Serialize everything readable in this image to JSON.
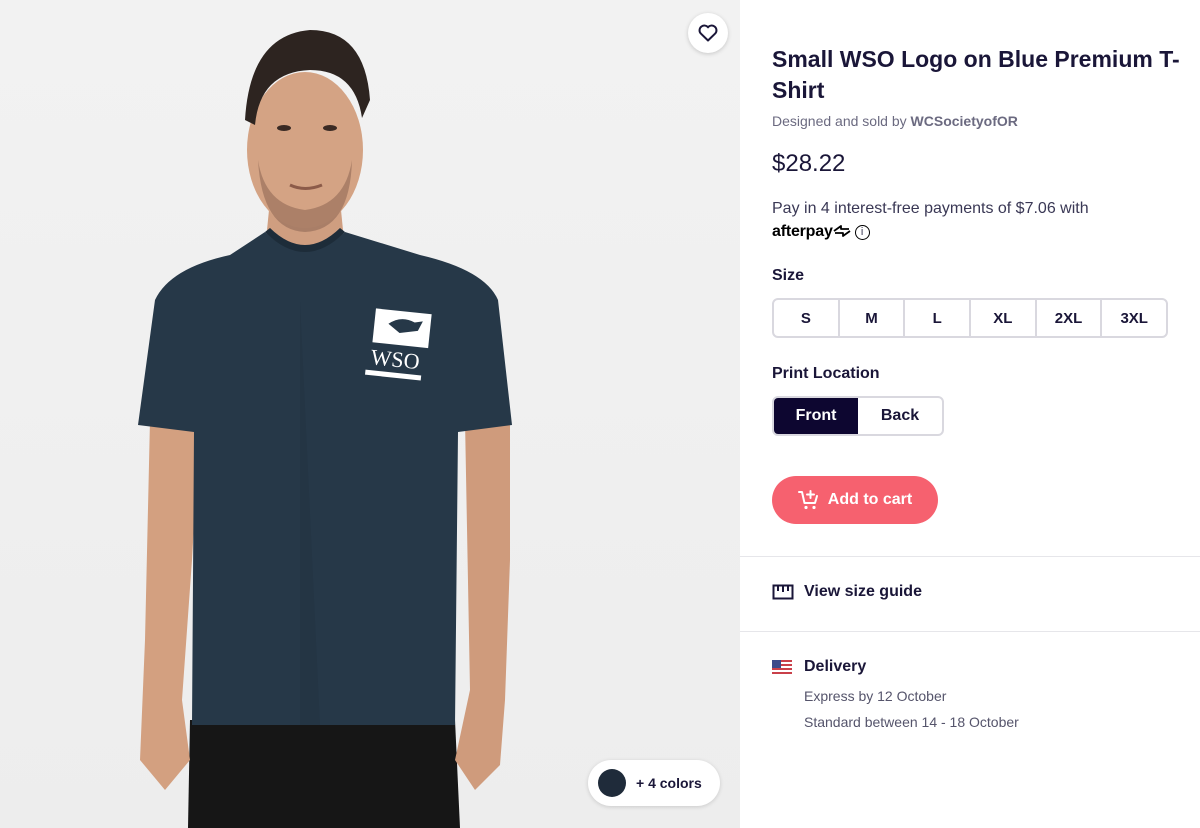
{
  "product": {
    "title": "Small WSO Logo on Blue Premium T-Shirt",
    "seller_prefix": "Designed and sold by ",
    "seller_name": "WCSocietyofOR",
    "price": "$28.22"
  },
  "afterpay": {
    "text": "Pay in 4 interest-free payments of $7.06 with",
    "brand": "afterpay",
    "info_glyph": "i"
  },
  "size": {
    "label": "Size",
    "options": [
      "S",
      "M",
      "L",
      "XL",
      "2XL",
      "3XL"
    ]
  },
  "print_location": {
    "label": "Print Location",
    "options": [
      "Front",
      "Back"
    ],
    "selected": "Front"
  },
  "actions": {
    "add_to_cart": "Add to cart",
    "size_guide": "View size guide"
  },
  "delivery": {
    "title": "Delivery",
    "express": "Express by 12 October",
    "standard": "Standard between 14 - 18 October"
  },
  "gallery": {
    "colors_label": "+ 4 colors",
    "shirt_color": "#263848",
    "logo_text": "WSO"
  },
  "colors": {
    "accent": "#f6616f",
    "selected": "#0d0630",
    "text": "#1a1638"
  }
}
